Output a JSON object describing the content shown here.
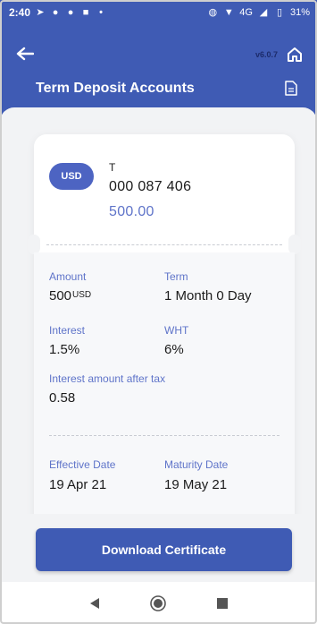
{
  "status_bar": {
    "time": "2:40",
    "network": "4G",
    "battery": "31%"
  },
  "header": {
    "version": "v6.0.7",
    "title": "Term Deposit Accounts"
  },
  "account": {
    "currency": "USD",
    "name": "T",
    "number": "000 087 406",
    "balance": "500.00"
  },
  "details": {
    "amount_label": "Amount",
    "amount_value": "500",
    "amount_unit": "USD",
    "term_label": "Term",
    "term_value": "1 Month 0 Day",
    "interest_label": "Interest",
    "interest_value": "1.5%",
    "wht_label": "WHT",
    "wht_value": "6%",
    "interest_after_tax_label": "Interest amount after tax",
    "interest_after_tax_value": "0.58",
    "effective_date_label": "Effective Date",
    "effective_date_value": "19 Apr 21",
    "maturity_date_label": "Maturity Date",
    "maturity_date_value": "19 May 21"
  },
  "actions": {
    "download_label": "Download Certificate"
  },
  "colors": {
    "primary": "#3f5bb4",
    "accent_text": "#5f74c9",
    "badge": "#4d64c2"
  }
}
